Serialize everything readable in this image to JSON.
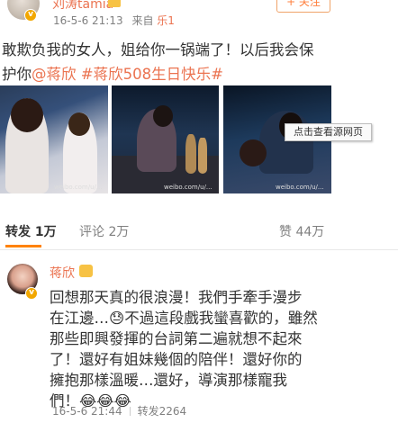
{
  "post": {
    "author": "刘涛tamia",
    "time": "16-5-6 21:13",
    "source_prefix": "来自",
    "source": "乐1",
    "follow_label": "+ 关注",
    "text_line1": "敢欺负我的女人，姐给你一锅端了！以后我会保",
    "text_prefix": "护你",
    "mention": "@蒋欣",
    "hashtag": "#蒋欣508生日快乐#",
    "images": [
      {
        "watermark": "weibo.com/u/..."
      },
      {
        "watermark": "weibo.com/u/..."
      },
      {
        "watermark": "weibo.com/u/..."
      }
    ]
  },
  "tooltip": "点击查看源网页",
  "actions": {
    "repost_label": "转发",
    "repost_count": "1万",
    "comment_label": "评论",
    "comment_count": "2万",
    "like_count": "44万"
  },
  "comment": {
    "author": "蒋欣",
    "lines": [
      "回想那天真的很浪漫！我們手牽手漫步",
      "在江邊…😓不過這段戲我蠻喜歡的，雖然",
      "那些即興發揮的台詞第二遍就想不起來",
      "了！還好有姐妹幾個的陪伴！還好你的",
      "擁抱那樣溫暖…還好，導演那樣寵我",
      "們！😂😂😂"
    ],
    "time": "16-5-6 21:44",
    "repost_label": "转发2264"
  },
  "colors": {
    "accent": "#eb7350",
    "tab_underline": "#ff8200"
  }
}
